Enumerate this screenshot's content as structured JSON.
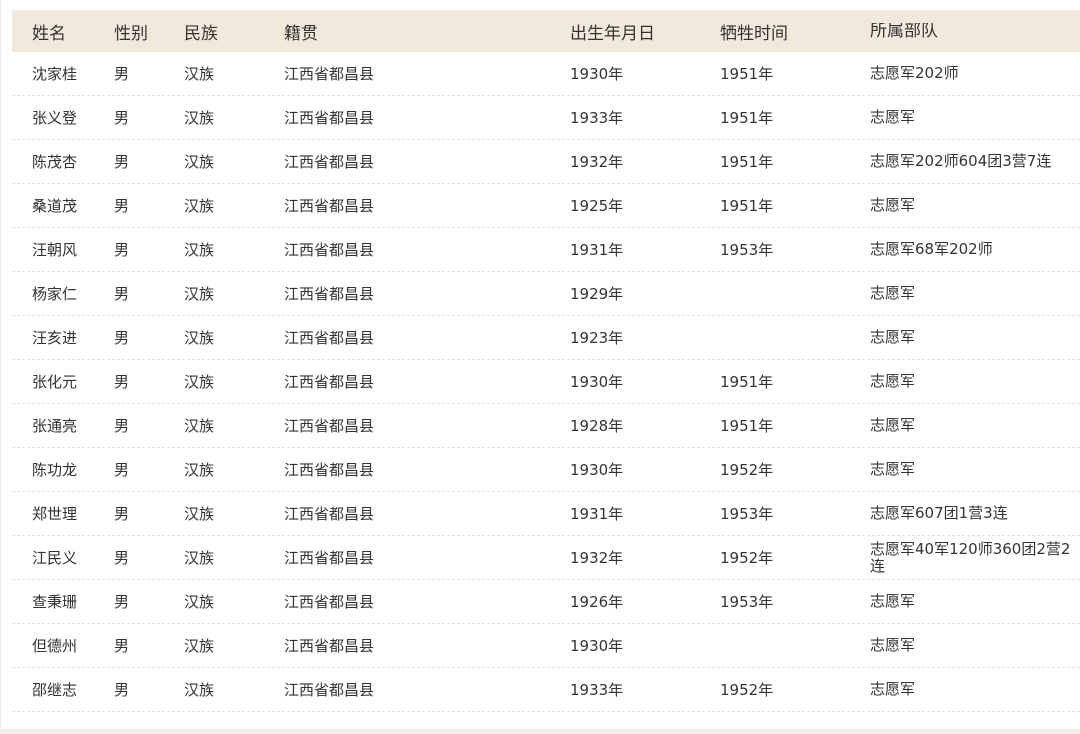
{
  "table": {
    "headers": [
      "姓名",
      "性别",
      "民族",
      "籍贯",
      "出生年月日",
      "牺牲时间",
      "所属部队"
    ],
    "rows": [
      [
        "沈家桂",
        "男",
        "汉族",
        "江西省都昌县",
        "1930年",
        "1951年",
        "志愿军202师"
      ],
      [
        "张义登",
        "男",
        "汉族",
        "江西省都昌县",
        "1933年",
        "1951年",
        "志愿军"
      ],
      [
        "陈茂杏",
        "男",
        "汉族",
        "江西省都昌县",
        "1932年",
        "1951年",
        "志愿军202师604团3营7连"
      ],
      [
        "桑道茂",
        "男",
        "汉族",
        "江西省都昌县",
        "1925年",
        "1951年",
        "志愿军"
      ],
      [
        "汪朝风",
        "男",
        "汉族",
        "江西省都昌县",
        "1931年",
        "1953年",
        "志愿军68军202师"
      ],
      [
        "杨家仁",
        "男",
        "汉族",
        "江西省都昌县",
        "1929年",
        "",
        "志愿军"
      ],
      [
        "汪亥进",
        "男",
        "汉族",
        "江西省都昌县",
        "1923年",
        "",
        "志愿军"
      ],
      [
        "张化元",
        "男",
        "汉族",
        "江西省都昌县",
        "1930年",
        "1951年",
        "志愿军"
      ],
      [
        "张通亮",
        "男",
        "汉族",
        "江西省都昌县",
        "1928年",
        "1951年",
        "志愿军"
      ],
      [
        "陈功龙",
        "男",
        "汉族",
        "江西省都昌县",
        "1930年",
        "1952年",
        "志愿军"
      ],
      [
        "郑世理",
        "男",
        "汉族",
        "江西省都昌县",
        "1931年",
        "1953年",
        "志愿军607团1营3连"
      ],
      [
        "江民义",
        "男",
        "汉族",
        "江西省都昌县",
        "1932年",
        "1952年",
        "志愿军40军120师360团2营2连"
      ],
      [
        "查秉珊",
        "男",
        "汉族",
        "江西省都昌县",
        "1926年",
        "1953年",
        "志愿军"
      ],
      [
        "但德州",
        "男",
        "汉族",
        "江西省都昌县",
        "1930年",
        "",
        "志愿军"
      ],
      [
        "邵继志",
        "男",
        "汉族",
        "江西省都昌县",
        "1933年",
        "1952年",
        "志愿军"
      ]
    ]
  }
}
